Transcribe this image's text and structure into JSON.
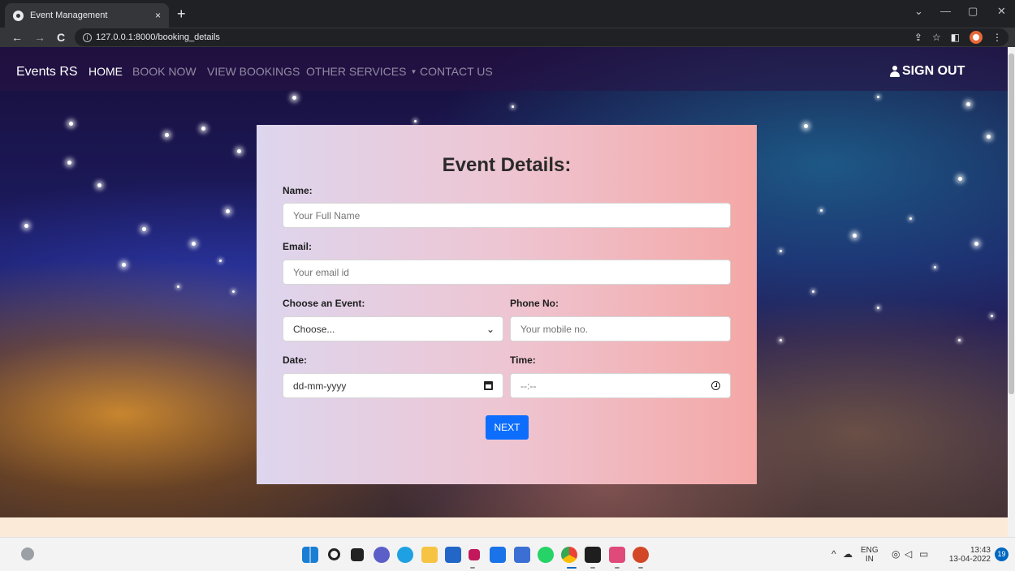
{
  "browser": {
    "tab_title": "Event Management",
    "tab_close": "×",
    "new_tab": "+",
    "url": "127.0.0.1:8000/booking_details",
    "back": "←",
    "forward": "→",
    "reload": "C",
    "win_min": "—",
    "win_restore": "▢",
    "win_close": "✕",
    "win_dropdown": "⌄"
  },
  "navbar": {
    "brand": "Events RS",
    "links": [
      "HOME",
      "BOOK NOW",
      "VIEW BOOKINGS",
      "OTHER SERVICES",
      "CONTACT US"
    ],
    "dropdown_caret": "▼",
    "signout": "SIGN OUT"
  },
  "form": {
    "title": "Event Details:",
    "name_label": "Name:",
    "name_placeholder": "Your Full Name",
    "email_label": "Email:",
    "email_placeholder": "Your email id",
    "event_label": "Choose an Event:",
    "event_selected": "Choose...",
    "phone_label": "Phone No:",
    "phone_placeholder": "Your mobile no.",
    "date_label": "Date:",
    "date_placeholder": "dd-mm-yyyy",
    "time_label": "Time:",
    "time_placeholder": "--:--",
    "next_button": "NEXT"
  },
  "taskbar": {
    "lang_top": "ENG",
    "lang_bottom": "IN",
    "time": "13:43",
    "date": "13-04-2022",
    "notifications": "19"
  },
  "colors": {
    "primary_button": "#0d6efd",
    "card_gradient_start": "#ddd6ee",
    "card_gradient_end": "#f4a7a5",
    "footer_strip": "#fbead8"
  }
}
